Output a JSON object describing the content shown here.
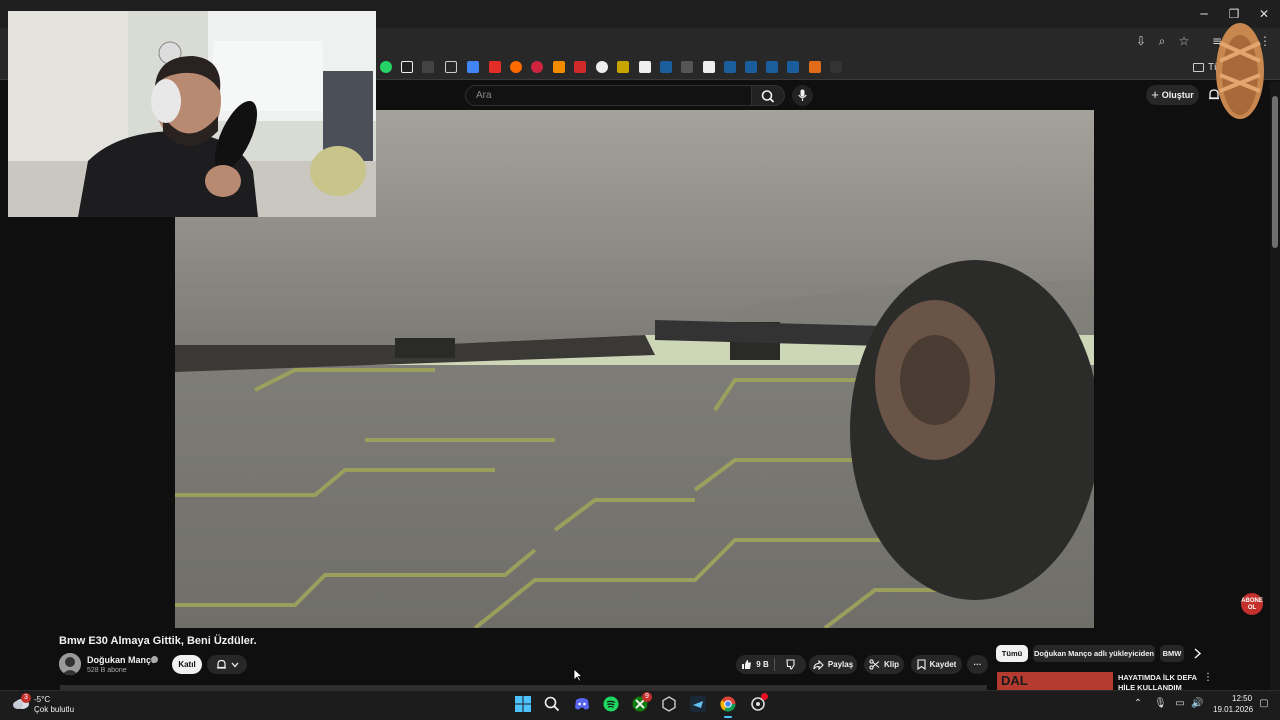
{
  "window": {
    "minimize_glyph": "─",
    "maximize_glyph": "❐",
    "close_glyph": "✕"
  },
  "bookmarks_bar": {
    "all_bookmarks_label": "Tü"
  },
  "masthead": {
    "search_placeholder": "Ara",
    "create_label": "Oluştur"
  },
  "video": {
    "title": "Bmw E30 Almaya Gittik, Beni Üzdüler.",
    "channel_name": "Doğukan Manço",
    "subscribers": "528 B abone",
    "join_label": "Katıl",
    "like_count": "9 B",
    "share_label": "Paylaş",
    "clip_label": "Klip",
    "save_label": "Kaydet",
    "more_glyph": "···"
  },
  "recommendations": {
    "chips": [
      "Tümü",
      "Doğukan Manço adlı yükleyiciden",
      "BMW"
    ],
    "first_title": "HAYATIMDA İLK DEFA HİLE KULLANDIM",
    "first_thumb_text": "DAL",
    "subscribe_badge": "ABONE OL"
  },
  "taskbar": {
    "weather_temp": "-5°C",
    "weather_desc": "Çok bulutlu",
    "weather_badge": "3",
    "xbox_badge": "9",
    "time": "12:50",
    "date": "19.01.2026"
  },
  "colors": {
    "background": "#0f0f0f",
    "chrome_toolbar": "#282828",
    "accent_red": "#c4302b",
    "chip_active": "#f1f1f1"
  }
}
